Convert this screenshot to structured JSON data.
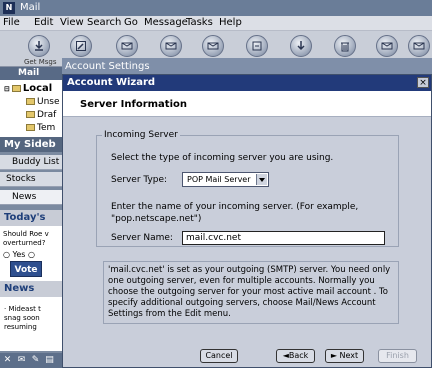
{
  "mail": {
    "app_icon_text": "N",
    "title": "Mail",
    "menus": [
      "File",
      "Edit",
      "View",
      "Search",
      "Go",
      "Message",
      "Tasks",
      "Help"
    ],
    "toolbar_label": "Get Msgs",
    "folders_header": "Mail Fold",
    "folders": [
      "Local",
      "Unse",
      "Draf",
      "Tem"
    ],
    "sidebar_header": "My Sideb",
    "sidebar_tabs": [
      "Buddy List",
      "Stocks",
      "News"
    ],
    "today_header": "Today's",
    "poll_question": "Should Roe v overturned?",
    "poll_option": "Yes",
    "vote_label": "Vote",
    "news_header": "News",
    "news_text": [
      "· Mideast t",
      "snag soon",
      "resuming"
    ]
  },
  "account_settings_title": "Account Settings",
  "wizard": {
    "title": "Account Wizard",
    "close_glyph": "×",
    "header": "Server Information",
    "group_legend": "Incoming Server",
    "select_prompt": "Select the type of incoming server you are using.",
    "server_type_label": "Server Type:",
    "server_type_value": "POP Mail Server",
    "name_prompt_1": "Enter the name of your incoming server. (For example,",
    "name_prompt_2": "\"pop.netscape.net\")",
    "server_name_label": "Server Name:",
    "server_name_value": "mail.cvc.net",
    "info_text": "'mail.cvc.net' is set as your outgoing (SMTP) server. You need only one outgoing server, even for multiple accounts. Normally you choose the outgoing server for your most active mail account . To specify additional outgoing servers, choose Mail/News Account Settings from the Edit menu.",
    "buttons": {
      "cancel": "Cancel",
      "back": "◄Back",
      "next": "► Next",
      "finish": "Finish"
    }
  }
}
